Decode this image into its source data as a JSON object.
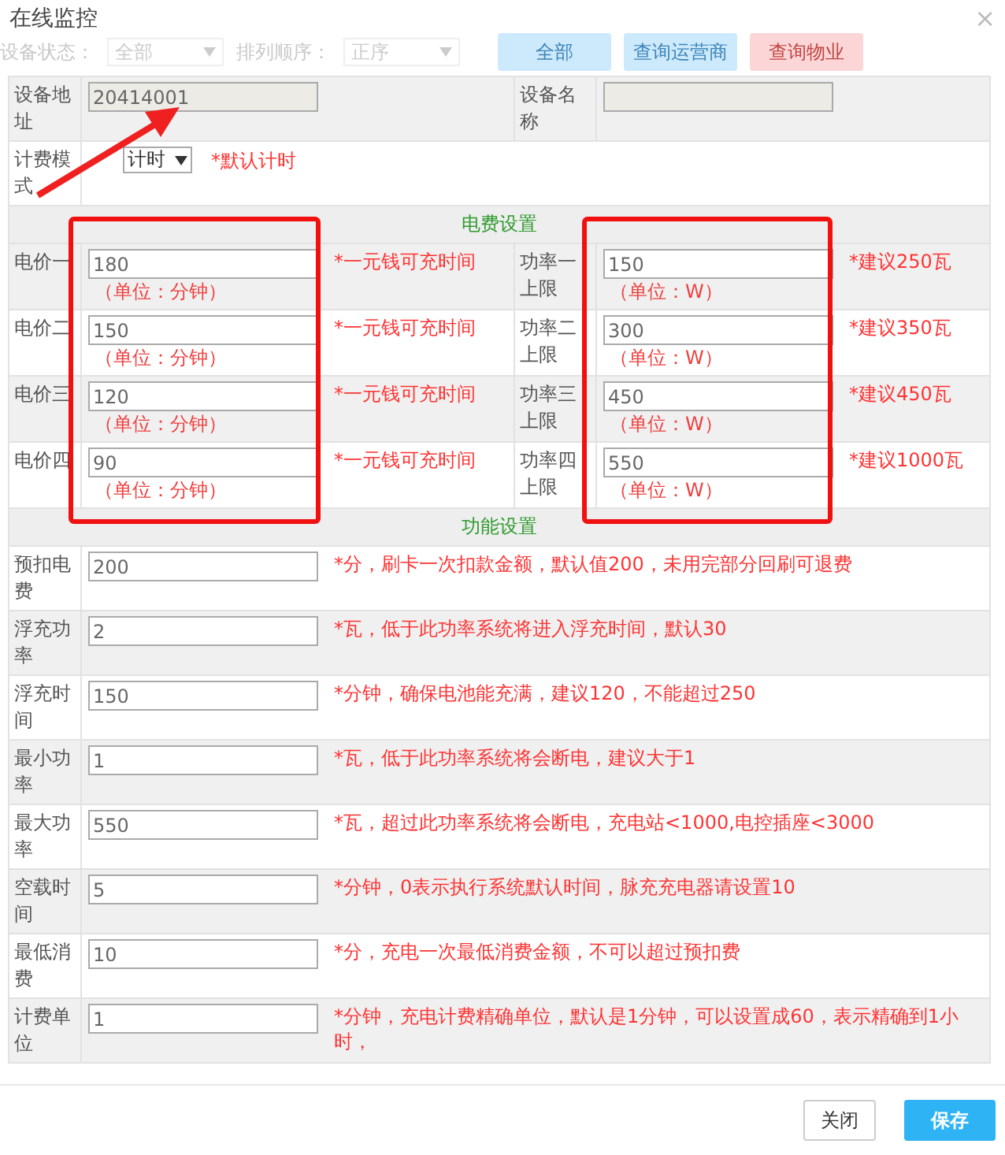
{
  "window": {
    "title": "在线监控",
    "close": "×"
  },
  "background_toolbar": {
    "status_label": "设备状态：",
    "status_value": "全部",
    "order_label": "排列顺序：",
    "order_value": "正序",
    "buttons": [
      {
        "label": "全部",
        "kind": "blue"
      },
      {
        "label": "查询运营商",
        "kind": "blue"
      },
      {
        "label": "查询物业",
        "kind": "red"
      }
    ]
  },
  "device": {
    "address_label": "设备地址",
    "address_value": "20414001",
    "name_label": "设备名称"
  },
  "billing_mode": {
    "label": "计费模式",
    "value": "计时",
    "note": "*默认计时"
  },
  "fee_section": {
    "title": "电费设置",
    "rows": [
      {
        "price_label": "电价一",
        "price_value": "180",
        "price_unit": "（单位：分钟）",
        "price_note": "*一元钱可充时间",
        "power_label": "功率一上限",
        "power_value": "150",
        "power_unit": "（单位：W）",
        "power_note": "*建议250瓦"
      },
      {
        "price_label": "电价二",
        "price_value": "150",
        "price_unit": "（单位：分钟）",
        "price_note": "*一元钱可充时间",
        "power_label": "功率二上限",
        "power_value": "300",
        "power_unit": "（单位：W）",
        "power_note": "*建议350瓦"
      },
      {
        "price_label": "电价三",
        "price_value": "120",
        "price_unit": "（单位：分钟）",
        "price_note": "*一元钱可充时间",
        "power_label": "功率三上限",
        "power_value": "450",
        "power_unit": "（单位：W）",
        "power_note": "*建议450瓦"
      },
      {
        "price_label": "电价四",
        "price_value": "90",
        "price_unit": "（单位：分钟）",
        "price_note": "*一元钱可充时间",
        "power_label": "功率四上限",
        "power_value": "550",
        "power_unit": "（单位：W）",
        "power_note": "*建议1000瓦"
      }
    ]
  },
  "function_section": {
    "title": "功能设置",
    "rows": [
      {
        "label": "预扣电费",
        "value": "200",
        "note": "*分，刷卡一次扣款金额，默认值200，未用完部分回刷可退费"
      },
      {
        "label": "浮充功率",
        "value": "2",
        "note": "*瓦，低于此功率系统将进入浮充时间，默认30"
      },
      {
        "label": "浮充时间",
        "value": "150",
        "note": "*分钟，确保电池能充满，建议120，不能超过250"
      },
      {
        "label": "最小功率",
        "value": "1",
        "note": "*瓦，低于此功率系统将会断电，建议大于1"
      },
      {
        "label": "最大功率",
        "value": "550",
        "note": "*瓦，超过此功率系统将会断电，充电站<1000,电控插座<3000"
      },
      {
        "label": "空载时间",
        "value": "5",
        "note": "*分钟，0表示执行系统默认时间，脉充充电器请设置10"
      },
      {
        "label": "最低消费",
        "value": "10",
        "note": "*分，充电一次最低消费金额，不可以超过预扣费"
      },
      {
        "label": "计费单位",
        "value": "1",
        "note": "*分钟，充电计费精确单位，默认是1分钟，可以设置成60，表示精确到1小时，"
      }
    ]
  },
  "buttons": [
    {
      "label": "关闭",
      "kind": "default"
    },
    {
      "label": "保存",
      "kind": "primary"
    }
  ]
}
